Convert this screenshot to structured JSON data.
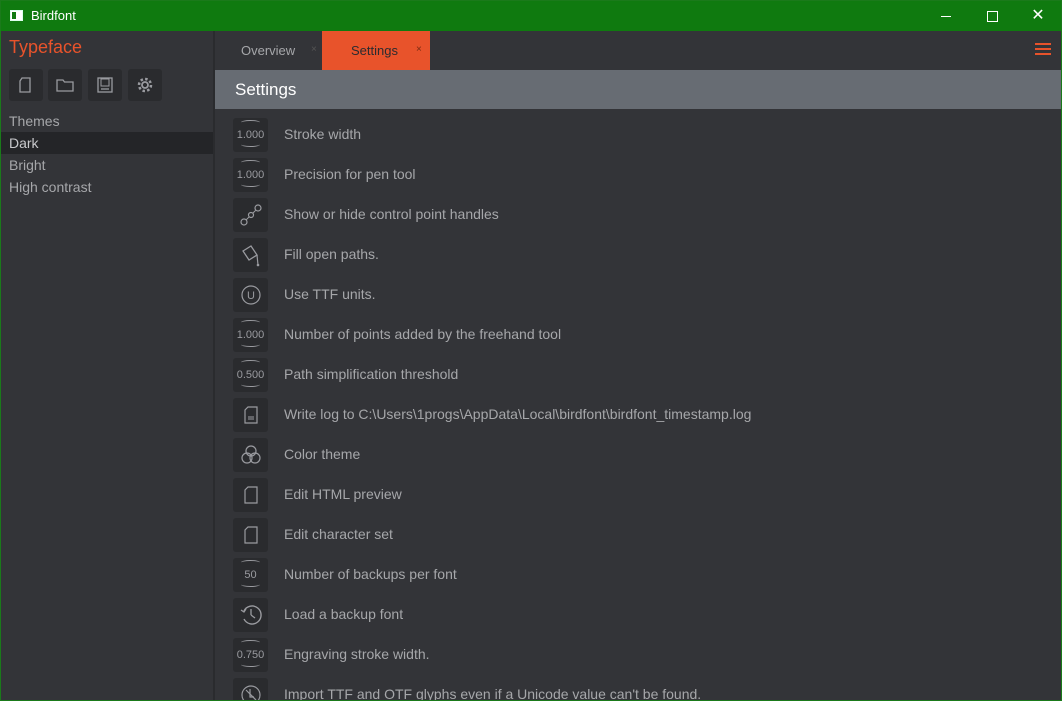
{
  "window": {
    "title": "Birdfont",
    "controls": {
      "minimize": "minimize-icon",
      "maximize": "maximize-icon",
      "close": "close-icon"
    }
  },
  "sidebar": {
    "brand": "Typeface",
    "tools": [
      {
        "name": "new-file-icon"
      },
      {
        "name": "open-folder-icon"
      },
      {
        "name": "save-icon"
      },
      {
        "name": "gear-icon"
      }
    ],
    "items": [
      {
        "label": "Themes",
        "selected": false
      },
      {
        "label": "Dark",
        "selected": true
      },
      {
        "label": "Bright",
        "selected": false
      },
      {
        "label": "High contrast",
        "selected": false
      }
    ]
  },
  "tabs": [
    {
      "label": "Overview",
      "close": "×",
      "active": false
    },
    {
      "label": "Settings",
      "close": "×",
      "active": true
    }
  ],
  "header": {
    "title": "Settings"
  },
  "settings": [
    {
      "label": "Stroke width",
      "icon": "number-spinner-icon",
      "value": "1.000"
    },
    {
      "label": "Precision for pen tool",
      "icon": "number-spinner-icon",
      "value": "1.000"
    },
    {
      "label": "Show or hide control point handles",
      "icon": "control-handles-icon"
    },
    {
      "label": "Fill open paths.",
      "icon": "fill-bucket-icon"
    },
    {
      "label": "Use TTF units.",
      "icon": "ttf-units-icon",
      "value": "U"
    },
    {
      "label": "Number of points added by the freehand tool",
      "icon": "number-spinner-icon",
      "value": "1.000"
    },
    {
      "label": "Path simplification threshold",
      "icon": "number-spinner-icon",
      "value": "0.500"
    },
    {
      "label": "Write log to C:\\Users\\1progs\\AppData\\Local\\birdfont\\birdfont_timestamp.log",
      "icon": "log-file-icon"
    },
    {
      "label": "Color theme",
      "icon": "color-circles-icon"
    },
    {
      "label": "Edit HTML preview",
      "icon": "document-icon"
    },
    {
      "label": "Edit character set",
      "icon": "document-icon"
    },
    {
      "label": "Number of backups per font",
      "icon": "number-spinner-icon",
      "value": "50"
    },
    {
      "label": "Load a backup font",
      "icon": "clock-icon"
    },
    {
      "label": "Engraving stroke width.",
      "icon": "number-spinner-icon",
      "value": "0.750"
    },
    {
      "label": "Import TTF and OTF glyphs even if a Unicode value can't be found.",
      "icon": "import-glyph-icon"
    }
  ],
  "colors": {
    "accent": "#e8532b",
    "titlebar": "#0f7a0f",
    "background": "#333438",
    "header": "#676c73"
  }
}
